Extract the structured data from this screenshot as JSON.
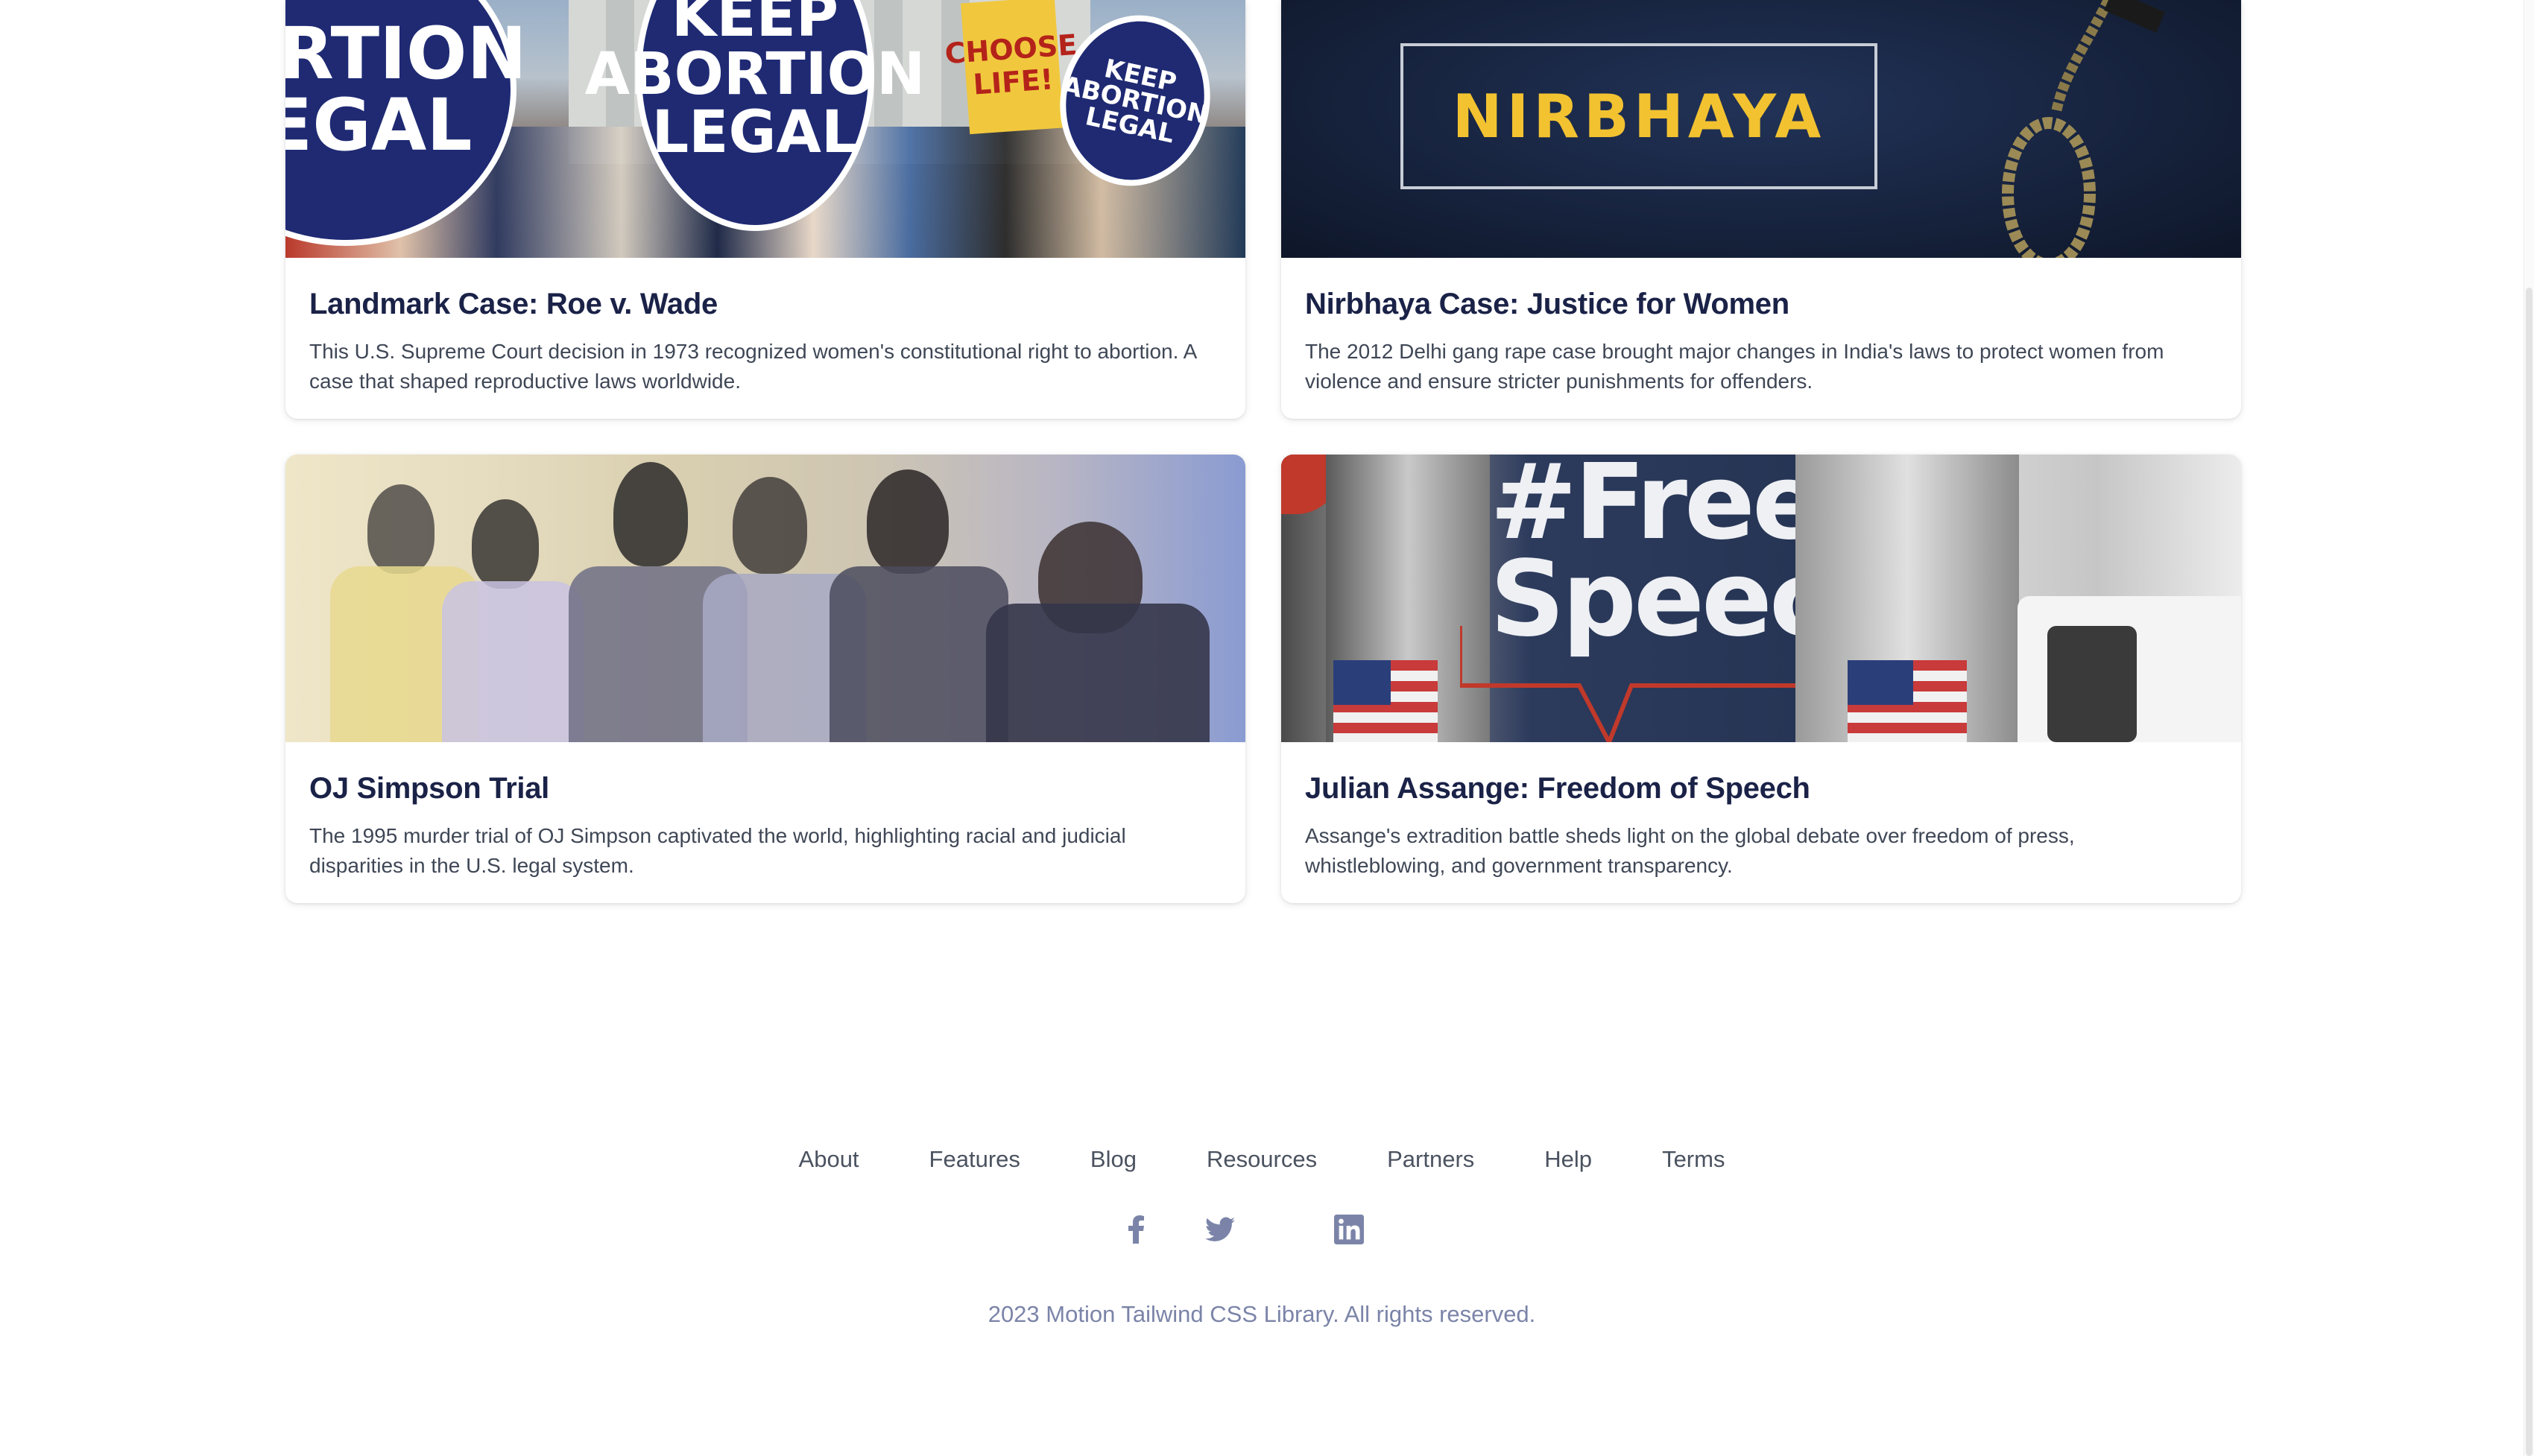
{
  "cards": [
    {
      "image_alt": "Keep Abortion Legal protest",
      "image_text": {
        "sign_1": "BORTION LEGAL",
        "sign_2": "KEEP ABORTION LEGAL",
        "sign_3": "KEEP ABORTION LEGAL",
        "sign_4": "CHOOSE LIFE!"
      },
      "title": "Landmark Case: Roe v. Wade",
      "description": "This U.S. Supreme Court decision in 1973 recognized women's constitutional right to abortion. A case that shaped reproductive laws worldwide."
    },
    {
      "image_alt": "Nirbhaya",
      "image_text": {
        "banner": "NIRBHAYA"
      },
      "title": "Nirbhaya Case: Justice for Women",
      "description": "The 2012 Delhi gang rape case brought major changes in India's laws to protect women from violence and ensure stricter punishments for offenders."
    },
    {
      "image_alt": "Courtroom sketch of OJ Simpson trial",
      "title": "OJ Simpson Trial",
      "description": "The 1995 murder trial of OJ Simpson captivated the world, highlighting racial and judicial disparities in the U.S. legal system."
    },
    {
      "image_alt": "Free Speech banner with Julian Assange",
      "image_text": {
        "banner": "#Free Speech*"
      },
      "title": "Julian Assange: Freedom of Speech",
      "description": "Assange's extradition battle sheds light on the global debate over freedom of press, whistleblowing, and government transparency."
    }
  ],
  "footer": {
    "links": [
      "About",
      "Features",
      "Blog",
      "Resources",
      "Partners",
      "Help",
      "Terms"
    ],
    "socials": [
      "facebook-icon",
      "twitter-icon",
      "linkedin-icon"
    ],
    "copyright": "2023 Motion Tailwind CSS Library. All rights reserved."
  },
  "colors": {
    "title": "#1a2247",
    "body_text": "#3f4756",
    "footer_link": "#4b5260",
    "footer_muted": "#7b84a8"
  }
}
